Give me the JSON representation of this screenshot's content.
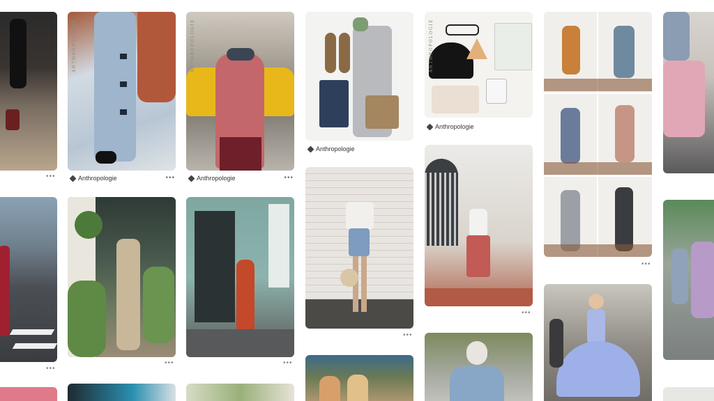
{
  "source_label": "Anthropologie",
  "brand_watermark": "ANTHROPOLOGIE",
  "more_glyph": "•••",
  "colors": {
    "background": "#ffffff",
    "text": "#333333",
    "muted": "#888888"
  }
}
